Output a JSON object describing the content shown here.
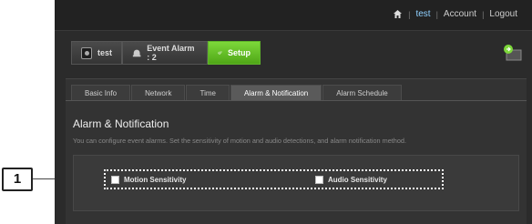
{
  "callout": {
    "number": "1"
  },
  "topnav": {
    "user": "test",
    "account": "Account",
    "logout": "Logout",
    "separator": "|"
  },
  "mode_tabs": [
    {
      "label": "test",
      "icon": "camera-icon"
    },
    {
      "label": "Event Alarm : 2",
      "icon": "alarm-bell-icon"
    },
    {
      "label": "Setup",
      "icon": "gear-icon",
      "active": true
    }
  ],
  "sub_tabs": [
    {
      "label": "Basic Info"
    },
    {
      "label": "Network"
    },
    {
      "label": "Time"
    },
    {
      "label": "Alarm & Notification",
      "active": true
    },
    {
      "label": "Alarm Schedule"
    }
  ],
  "section": {
    "title": "Alarm & Notification",
    "description": "You can configure event alarms. Set the sensitivity of motion and audio detections, and alarm notification method."
  },
  "options": {
    "motion_label": "Motion Sensitivity",
    "audio_label": "Audio Sensitivity"
  },
  "colors": {
    "accent_green": "#5fb52a",
    "nav_user": "#8fd0ff"
  }
}
